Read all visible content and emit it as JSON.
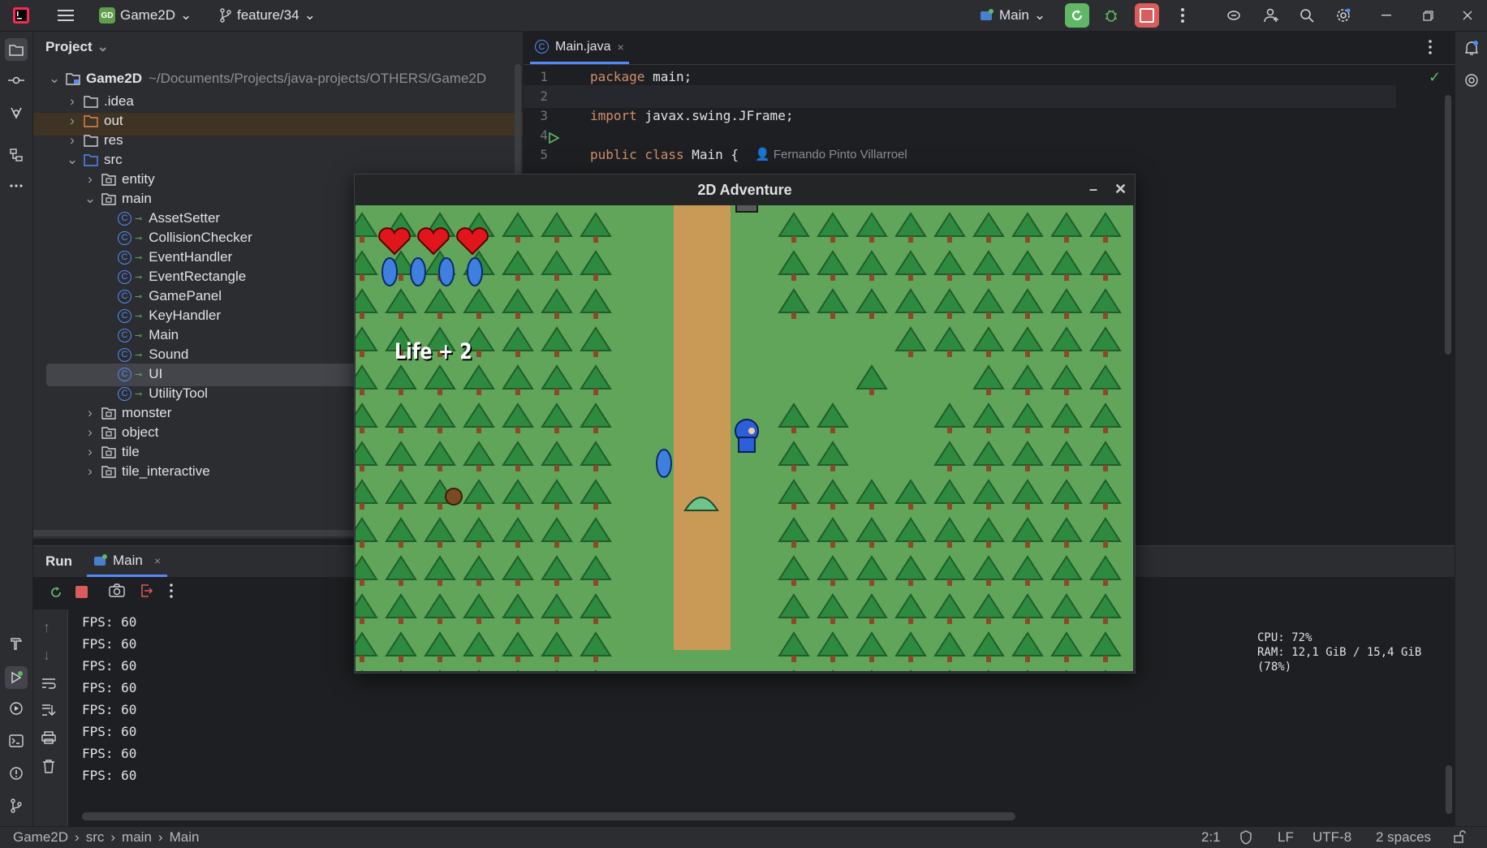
{
  "titlebar": {
    "project_badge": "GD",
    "project_name": "Game2D",
    "branch": "feature/34",
    "run_config": "Main"
  },
  "project_panel": {
    "title": "Project",
    "root_name": "Game2D",
    "root_path": "~/Documents/Projects/java-projects/OTHERS/Game2D",
    "items": [
      {
        "label": ".idea"
      },
      {
        "label": "out"
      },
      {
        "label": "res"
      },
      {
        "label": "src"
      },
      {
        "label": "entity"
      },
      {
        "label": "main"
      },
      {
        "label": "AssetSetter"
      },
      {
        "label": "CollisionChecker"
      },
      {
        "label": "EventHandler"
      },
      {
        "label": "EventRectangle"
      },
      {
        "label": "GamePanel"
      },
      {
        "label": "KeyHandler"
      },
      {
        "label": "Main"
      },
      {
        "label": "Sound"
      },
      {
        "label": "UI"
      },
      {
        "label": "UtilityTool"
      },
      {
        "label": "monster"
      },
      {
        "label": "object"
      },
      {
        "label": "tile"
      },
      {
        "label": "tile_interactive"
      }
    ]
  },
  "editor": {
    "tab": "Main.java",
    "lines": [
      {
        "num": "1",
        "kw": "package",
        "rest": " main;"
      },
      {
        "num": "2",
        "kw": "",
        "rest": ""
      },
      {
        "num": "3",
        "kw": "import",
        "rest": " javax.swing.JFrame;"
      },
      {
        "num": "4",
        "kw": "",
        "rest": ""
      },
      {
        "num": "5",
        "kw": "public class",
        "rest": " Main {"
      }
    ],
    "author": "Fernando Pinto Villarroel"
  },
  "run_panel": {
    "title": "Run",
    "tab": "Main",
    "console": [
      "FPS: 60",
      "FPS: 60",
      "FPS: 60",
      "FPS: 60",
      "FPS: 60",
      "FPS: 60",
      "FPS: 60",
      "FPS: 60"
    ],
    "cpu": "CPU: 72%",
    "ram": "RAM: 12,1 GiB / 15,4 GiB (78%)"
  },
  "game": {
    "title": "2D Adventure",
    "message": "Life + 2",
    "hearts": 3,
    "mana_crystals": 4
  },
  "statusbar": {
    "crumbs": [
      "Game2D",
      "src",
      "main",
      "Main"
    ],
    "position": "2:1",
    "line_sep": "LF",
    "encoding": "UTF-8",
    "indent": "2 spaces"
  },
  "colors": {
    "grass": "#60a55a",
    "path": "#c89a56",
    "tree": "#2e8a3e",
    "accent": "#548af7"
  }
}
